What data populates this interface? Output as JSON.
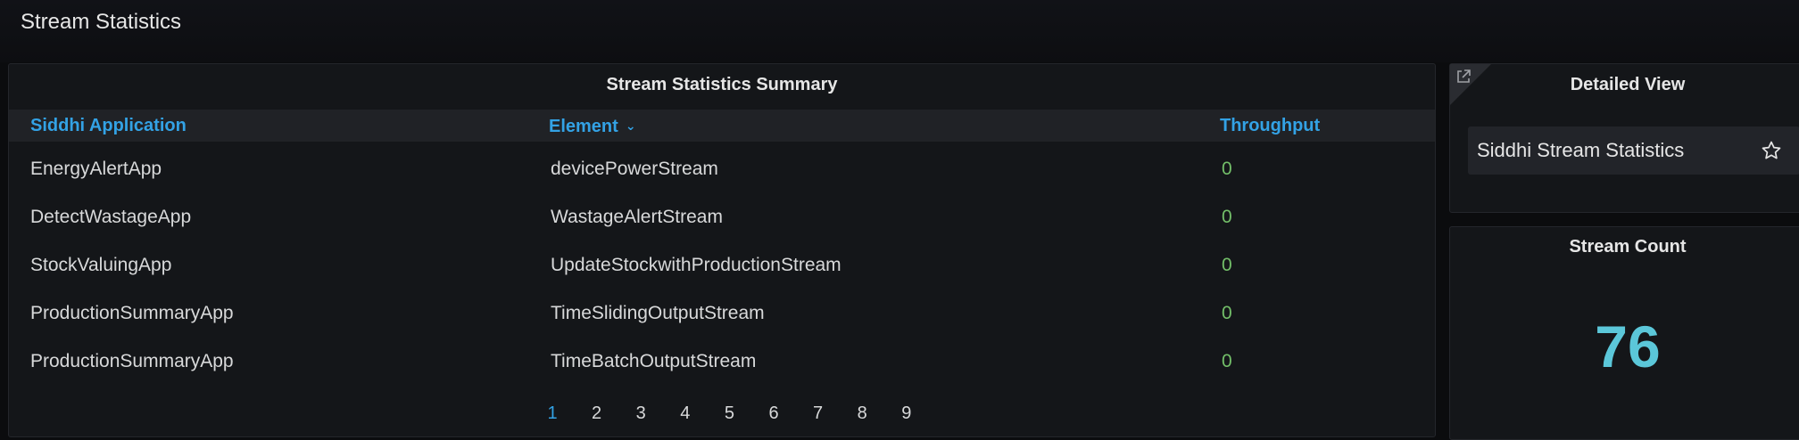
{
  "page": {
    "title": "Stream Statistics"
  },
  "summary": {
    "title": "Stream Statistics Summary",
    "columns": [
      "Siddhi Application",
      "Element",
      "Throughput"
    ],
    "sort_icon": "chevron-down-icon",
    "rows": [
      [
        "EnergyAlertApp",
        "devicePowerStream",
        "0"
      ],
      [
        "DetectWastageApp",
        "WastageAlertStream",
        "0"
      ],
      [
        "StockValuingApp",
        "UpdateStockwithProductionStream",
        "0"
      ],
      [
        "ProductionSummaryApp",
        "TimeSlidingOutputStream",
        "0"
      ],
      [
        "ProductionSummaryApp",
        "TimeBatchOutputStream",
        "0"
      ]
    ],
    "pages": [
      "1",
      "2",
      "3",
      "4",
      "5",
      "6",
      "7",
      "8",
      "9"
    ],
    "active_page": "1"
  },
  "detailed": {
    "title": "Detailed View",
    "corner_icon": "external-link-icon",
    "link_label": "Siddhi Stream Statistics",
    "link_icon": "star-icon"
  },
  "count": {
    "title": "Stream Count",
    "value": "76"
  },
  "colors": {
    "background": "#0b0c0e",
    "panel": "#141619",
    "header_link": "#33a2e5",
    "throughput": "#73bf69",
    "stat_value": "#5bc7d9"
  }
}
